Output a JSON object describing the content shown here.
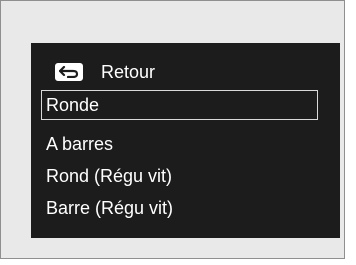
{
  "menu": {
    "back_label": "Retour",
    "items": [
      {
        "label": "Ronde",
        "selected": true
      },
      {
        "label": "A barres",
        "selected": false
      },
      {
        "label": "Rond (Régu vit)",
        "selected": false
      },
      {
        "label": "Barre (Régu vit)",
        "selected": false
      }
    ]
  },
  "icons": {
    "back": "return-arrow-icon"
  },
  "colors": {
    "background": "#e9e9e9",
    "screen": "#1c1c1c",
    "text": "#ffffff",
    "selection_border": "#d9d9d9"
  }
}
